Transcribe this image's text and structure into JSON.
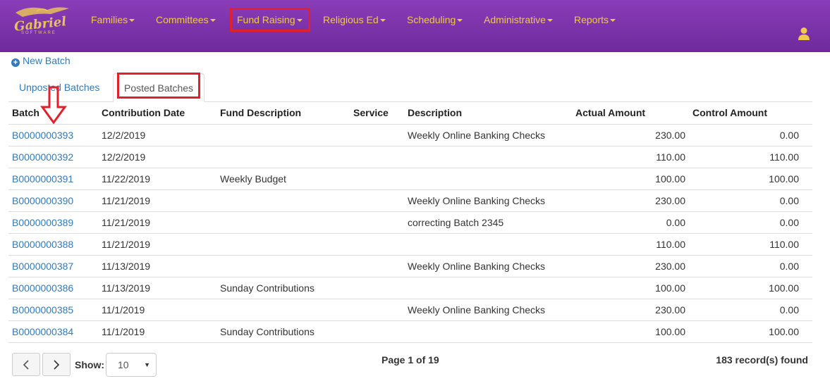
{
  "brand": {
    "name": "Gabriel",
    "sub": "SOFTWARE"
  },
  "nav": {
    "items": [
      {
        "label": "Families"
      },
      {
        "label": "Committees"
      },
      {
        "label": "Fund Raising"
      },
      {
        "label": "Religious Ed"
      },
      {
        "label": "Scheduling"
      },
      {
        "label": "Administrative"
      },
      {
        "label": "Reports"
      }
    ]
  },
  "actions": {
    "new_batch": "New Batch"
  },
  "tabs": [
    {
      "label": "Unposted Batches"
    },
    {
      "label": "Posted Batches"
    }
  ],
  "table": {
    "headers": [
      "Batch",
      "Contribution Date",
      "Fund Description",
      "Service",
      "Description",
      "Actual Amount",
      "Control Amount"
    ],
    "rows": [
      {
        "batch": "B0000000393",
        "date": "12/2/2019",
        "fund": "",
        "service": "",
        "description": "Weekly Online Banking Checks",
        "actual": "230.00",
        "control": "0.00"
      },
      {
        "batch": "B0000000392",
        "date": "12/2/2019",
        "fund": "",
        "service": "",
        "description": "",
        "actual": "110.00",
        "control": "110.00"
      },
      {
        "batch": "B0000000391",
        "date": "11/22/2019",
        "fund": "Weekly Budget",
        "service": "",
        "description": "",
        "actual": "100.00",
        "control": "100.00"
      },
      {
        "batch": "B0000000390",
        "date": "11/21/2019",
        "fund": "",
        "service": "",
        "description": "Weekly Online Banking Checks",
        "actual": "230.00",
        "control": "0.00"
      },
      {
        "batch": "B0000000389",
        "date": "11/21/2019",
        "fund": "",
        "service": "",
        "description": "correcting Batch 2345",
        "actual": "0.00",
        "control": "0.00"
      },
      {
        "batch": "B0000000388",
        "date": "11/21/2019",
        "fund": "",
        "service": "",
        "description": "",
        "actual": "110.00",
        "control": "110.00"
      },
      {
        "batch": "B0000000387",
        "date": "11/13/2019",
        "fund": "",
        "service": "",
        "description": "Weekly Online Banking Checks",
        "actual": "230.00",
        "control": "0.00"
      },
      {
        "batch": "B0000000386",
        "date": "11/13/2019",
        "fund": "Sunday Contributions",
        "service": "",
        "description": "",
        "actual": "100.00",
        "control": "100.00"
      },
      {
        "batch": "B0000000385",
        "date": "11/1/2019",
        "fund": "",
        "service": "",
        "description": "Weekly Online Banking Checks",
        "actual": "230.00",
        "control": "0.00"
      },
      {
        "batch": "B0000000384",
        "date": "11/1/2019",
        "fund": "Sunday Contributions",
        "service": "",
        "description": "",
        "actual": "100.00",
        "control": "100.00"
      }
    ]
  },
  "pager": {
    "prev_icon": "chevron-left-icon",
    "next_icon": "chevron-right-icon",
    "show_label": "Show:",
    "page_size": "10",
    "page_info": "Page 1 of 19",
    "records": "183 record(s) found"
  },
  "colors": {
    "navbar": "#7b33aa",
    "nav_text": "#f1c84a",
    "link": "#337ab7",
    "highlight": "#e0202a"
  }
}
